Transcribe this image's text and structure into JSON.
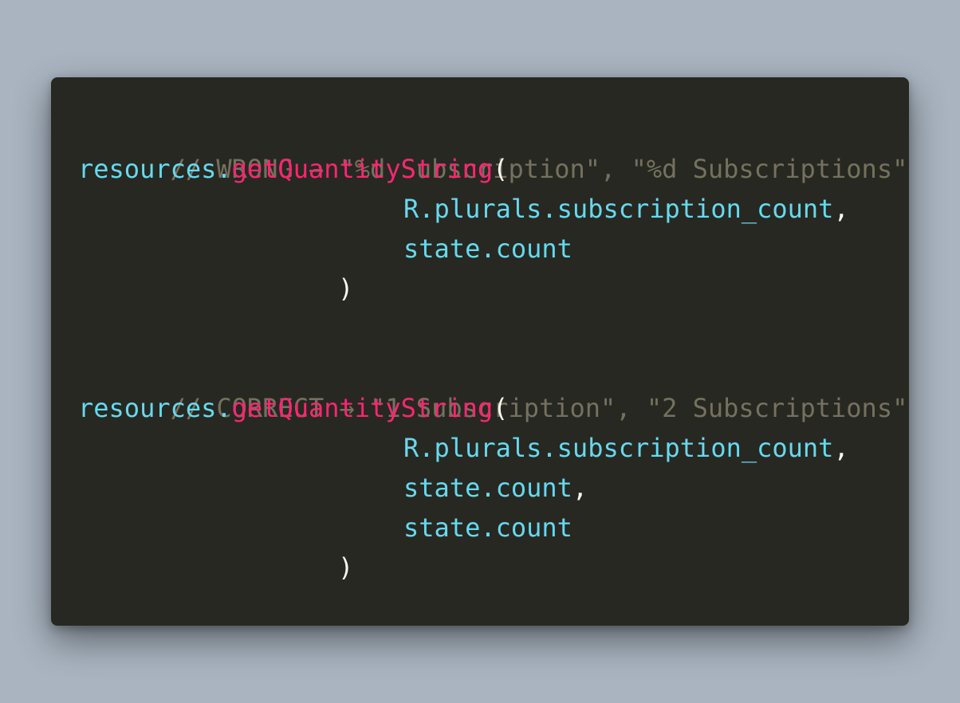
{
  "snippet": {
    "block1": {
      "comment": "// WRONG → \"%d Subscription\", \"%d Subscriptions\"",
      "receiver": "resources.",
      "method": "getQuantityString",
      "open_paren": "(",
      "arg1": "R.plurals.subscription_count",
      "arg1_comma": ",",
      "arg2": "state.count",
      "close_paren": ")"
    },
    "block2": {
      "comment": "// CORRECT → \"1 Subscription\", \"2 Subscriptions\"",
      "receiver": "resources.",
      "method": "getQuantityString",
      "open_paren": "(",
      "arg1": "R.plurals.subscription_count",
      "arg1_comma": ",",
      "arg2": "state.count",
      "arg2_comma": ",",
      "arg3": "state.count",
      "close_paren": ")"
    }
  },
  "colors": {
    "background": "#a9b4c0",
    "editor_bg": "#272822",
    "comment": "#75715e",
    "identifier": "#66d9ef",
    "method": "#f92672",
    "punctuation": "#f8f8f2"
  }
}
